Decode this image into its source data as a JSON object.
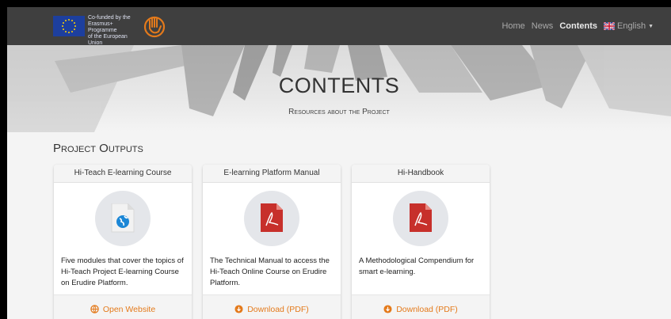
{
  "header": {
    "eu_text": [
      "Co-funded by the",
      "Erasmus+ Programme",
      "of the European Union"
    ],
    "nav": [
      {
        "label": "Home",
        "active": false
      },
      {
        "label": "News",
        "active": false
      },
      {
        "label": "Contents",
        "active": true
      }
    ],
    "language": "English"
  },
  "hero": {
    "title": "CONTENTS",
    "subtitle": "Resources about the Project"
  },
  "section_title": "Project Outputs",
  "cards": [
    {
      "title": "Hi-Teach E-learning Course",
      "icon": "web-file-icon",
      "description": "Five modules that cover the topics of Hi-Teach Project E-learning Course on Erudire Platform.",
      "action": "Open Website",
      "action_icon": "globe-icon"
    },
    {
      "title": "E-learning Platform Manual",
      "icon": "pdf-file-icon",
      "description": "The Technical Manual to access the Hi-Teach Online Course on Erudire Platform.",
      "action": "Download (PDF)",
      "action_icon": "download-circle-icon"
    },
    {
      "title": "Hi-Handbook",
      "icon": "pdf-file-icon",
      "description": "A Methodological Compendium for smart e-learning.",
      "action": "Download (PDF)",
      "action_icon": "download-circle-icon"
    }
  ],
  "colors": {
    "topbar": "#3f3f3f",
    "accent": "#e47a1b",
    "pdf_red": "#c7302b",
    "eu_blue": "#1d3f9e"
  }
}
